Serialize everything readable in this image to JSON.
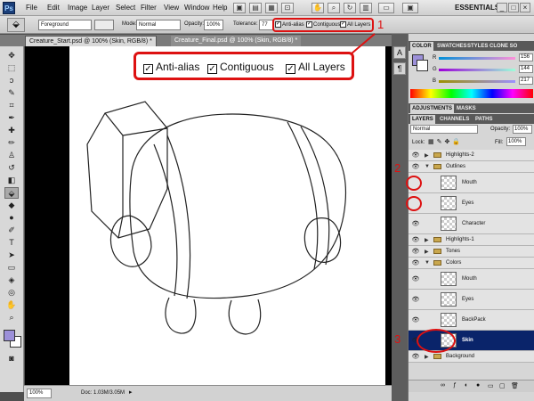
{
  "app": {
    "logo": "Ps",
    "workspace": "ESSENTIALS"
  },
  "menu": [
    "File",
    "Edit",
    "Image",
    "Layer",
    "Select",
    "Filter",
    "View",
    "Window",
    "Help"
  ],
  "options_bar": {
    "fill_source": "Foreground",
    "mode_label": "Mode:",
    "mode_value": "Normal",
    "opacity_label": "Opacity:",
    "opacity_value": "100%",
    "tolerance_label": "Tolerance:",
    "tolerance_value": "77",
    "anti_alias": "Anti-alias",
    "contiguous": "Contiguous",
    "all_layers": "All Layers"
  },
  "callout": {
    "anti_alias": "Anti-alias",
    "contiguous": "Contiguous",
    "all_layers": "All Layers"
  },
  "document_tabs": [
    {
      "label": "Creature_Start.psd @ 100% (Skin, RGB/8) *"
    },
    {
      "label": "Creature_Final.psd @ 100% (Skin, RGB/8) *"
    }
  ],
  "status": {
    "zoom": "100%",
    "doc": "Doc: 1.03M/3.05M"
  },
  "color_panel": {
    "tabs": [
      "COLOR",
      "SWATCHES",
      "STYLES",
      "CLONE SO"
    ],
    "r_label": "R",
    "r_value": "156",
    "g_label": "G",
    "g_value": "144",
    "b_label": "B",
    "b_value": "217",
    "swatch_color": "#9c90d9"
  },
  "adjustments_panel": {
    "tabs": [
      "ADJUSTMENTS",
      "MASKS"
    ]
  },
  "layers_panel": {
    "tabs": [
      "LAYERS",
      "CHANNELS",
      "PATHS"
    ],
    "blend_mode": "Normal",
    "opacity_label": "Opacity:",
    "opacity_value": "100%",
    "lock_label": "Lock:",
    "fill_label": "Fill:",
    "fill_value": "100%",
    "layers": [
      {
        "name": "Highlights-2",
        "kind": "group",
        "expanded": false,
        "visible": true,
        "indent": 0
      },
      {
        "name": "Outlines",
        "kind": "group",
        "expanded": true,
        "visible": true,
        "indent": 0
      },
      {
        "name": "Mouth",
        "kind": "layer",
        "visible": false,
        "indent": 1
      },
      {
        "name": "Eyes",
        "kind": "layer",
        "visible": false,
        "indent": 1
      },
      {
        "name": "Character",
        "kind": "layer",
        "visible": true,
        "indent": 1
      },
      {
        "name": "Highlights-1",
        "kind": "group",
        "expanded": false,
        "visible": true,
        "indent": 0
      },
      {
        "name": "Tones",
        "kind": "group",
        "expanded": false,
        "visible": true,
        "indent": 0
      },
      {
        "name": "Colors",
        "kind": "group",
        "expanded": true,
        "visible": true,
        "indent": 0
      },
      {
        "name": "Mouth",
        "kind": "layer",
        "visible": true,
        "indent": 1
      },
      {
        "name": "Eyes",
        "kind": "layer",
        "visible": true,
        "indent": 1
      },
      {
        "name": "BackPack",
        "kind": "layer",
        "visible": true,
        "indent": 1
      },
      {
        "name": "Skin",
        "kind": "layer",
        "visible": true,
        "indent": 1,
        "selected": true
      },
      {
        "name": "Background",
        "kind": "group",
        "expanded": false,
        "visible": true,
        "indent": 0
      }
    ]
  },
  "annotations": {
    "n1": "1",
    "n2": "2",
    "n3": "3"
  },
  "colors": {
    "annotation_red": "#dd1111",
    "selected_layer": "#0a246a",
    "foreground": "#9c90d9"
  },
  "icons": {
    "window_controls": [
      "minimize-icon",
      "restore-icon",
      "close-icon"
    ],
    "layer_footer": [
      "link-icon",
      "fx-icon",
      "mask-icon",
      "adjustment-icon",
      "folder-icon",
      "new-layer-icon",
      "trash-icon"
    ]
  }
}
